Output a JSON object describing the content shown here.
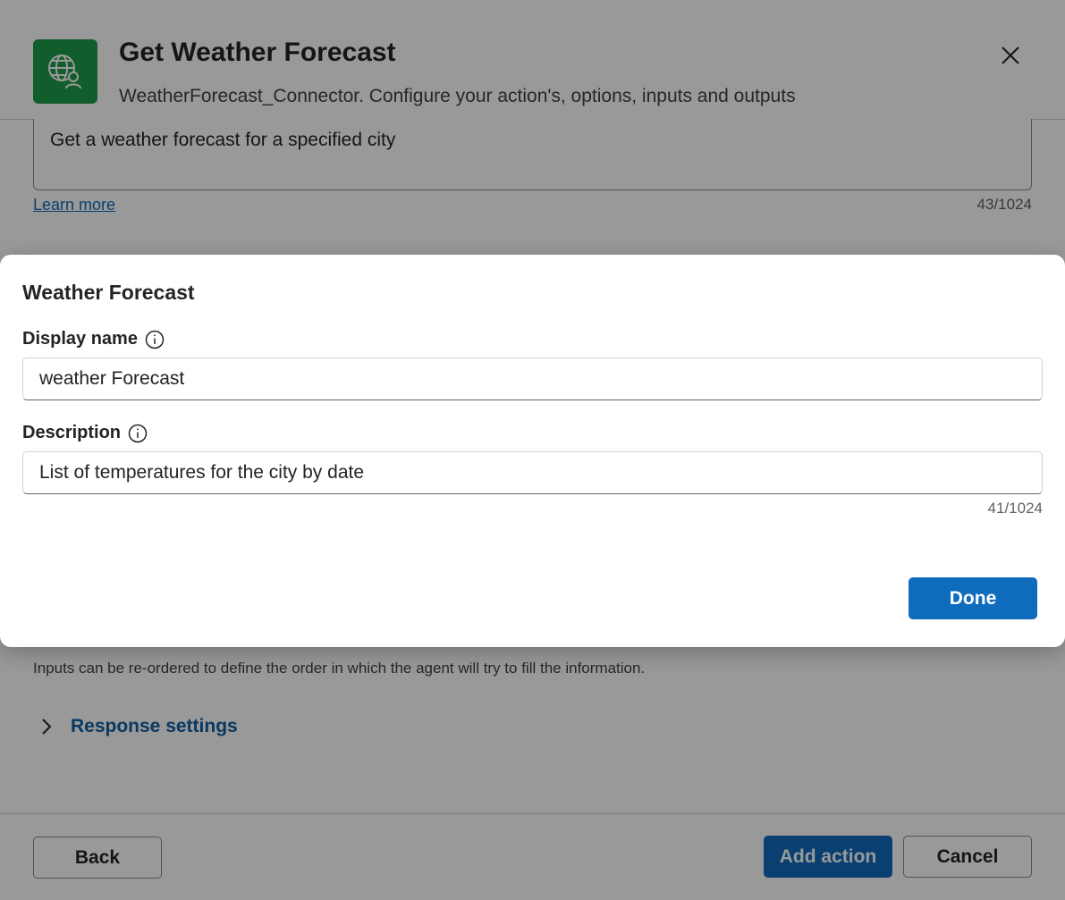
{
  "background_dialog": {
    "title": "Get Weather Forecast",
    "subtitle": "WeatherForecast_Connector. Configure your action's, options, inputs and outputs",
    "description_value": "Get a weather forecast for a specified city",
    "learn_more": "Learn more",
    "description_counter": "43/1024",
    "inputs_note": "Inputs can be re-ordered to define the order in which the agent will try to fill the information.",
    "response_settings": "Response settings",
    "footer": {
      "back": "Back",
      "add_action": "Add action",
      "cancel": "Cancel"
    },
    "icon": "globe-person-icon"
  },
  "modal": {
    "title": "Weather Forecast",
    "display_name_label": "Display name",
    "display_name_value": "weather Forecast",
    "description_label": "Description",
    "description_value": "List of temperatures for the city by date",
    "description_counter": "41/1024",
    "done": "Done"
  },
  "colors": {
    "brand_green": "#1f9b4a",
    "primary_blue": "#0f6cbd",
    "link_blue": "#115ea3",
    "overlay": "rgba(0,0,0,0.4)"
  }
}
